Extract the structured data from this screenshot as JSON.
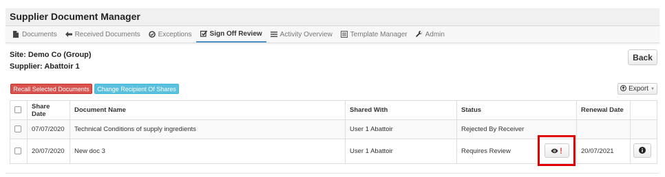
{
  "app": {
    "title": "Supplier Document Manager"
  },
  "nav": {
    "tabs": [
      {
        "label": "Documents",
        "icon": "file-icon"
      },
      {
        "label": "Received Documents",
        "icon": "arrow-left-icon"
      },
      {
        "label": "Exceptions",
        "icon": "ban-icon"
      },
      {
        "label": "Sign Off Review",
        "icon": "check-square-icon",
        "active": true
      },
      {
        "label": "Activity Overview",
        "icon": "list-icon"
      },
      {
        "label": "Template Manager",
        "icon": "template-icon"
      },
      {
        "label": "Admin",
        "icon": "wrench-icon"
      }
    ]
  },
  "context": {
    "site": "Site: Demo Co (Group)",
    "supplier": "Supplier: Abattoir 1"
  },
  "actions": {
    "back": "Back",
    "recall": "Recall Selected Documents",
    "change_recipient": "Change Recipient Of Shares",
    "export": "Export"
  },
  "table": {
    "headers": [
      "Share Date",
      "Document Name",
      "Shared With",
      "Status",
      "Renewal Date"
    ],
    "rows": [
      {
        "share_date": "07/07/2020",
        "document_name": "Technical Conditions of supply ingredients",
        "shared_with": "User 1 Abattoir",
        "status": "Rejected By Receiver",
        "renewal_date": ""
      },
      {
        "share_date": "20/07/2020",
        "document_name": "New doc 3",
        "shared_with": "User 1 Abattoir",
        "status": "Requires Review",
        "renewal_date": "20/07/2021"
      }
    ]
  },
  "colors": {
    "danger": "#d9534f",
    "info": "#5bc0de",
    "highlight": "#e00000",
    "active_tab": "#4a90c9"
  }
}
